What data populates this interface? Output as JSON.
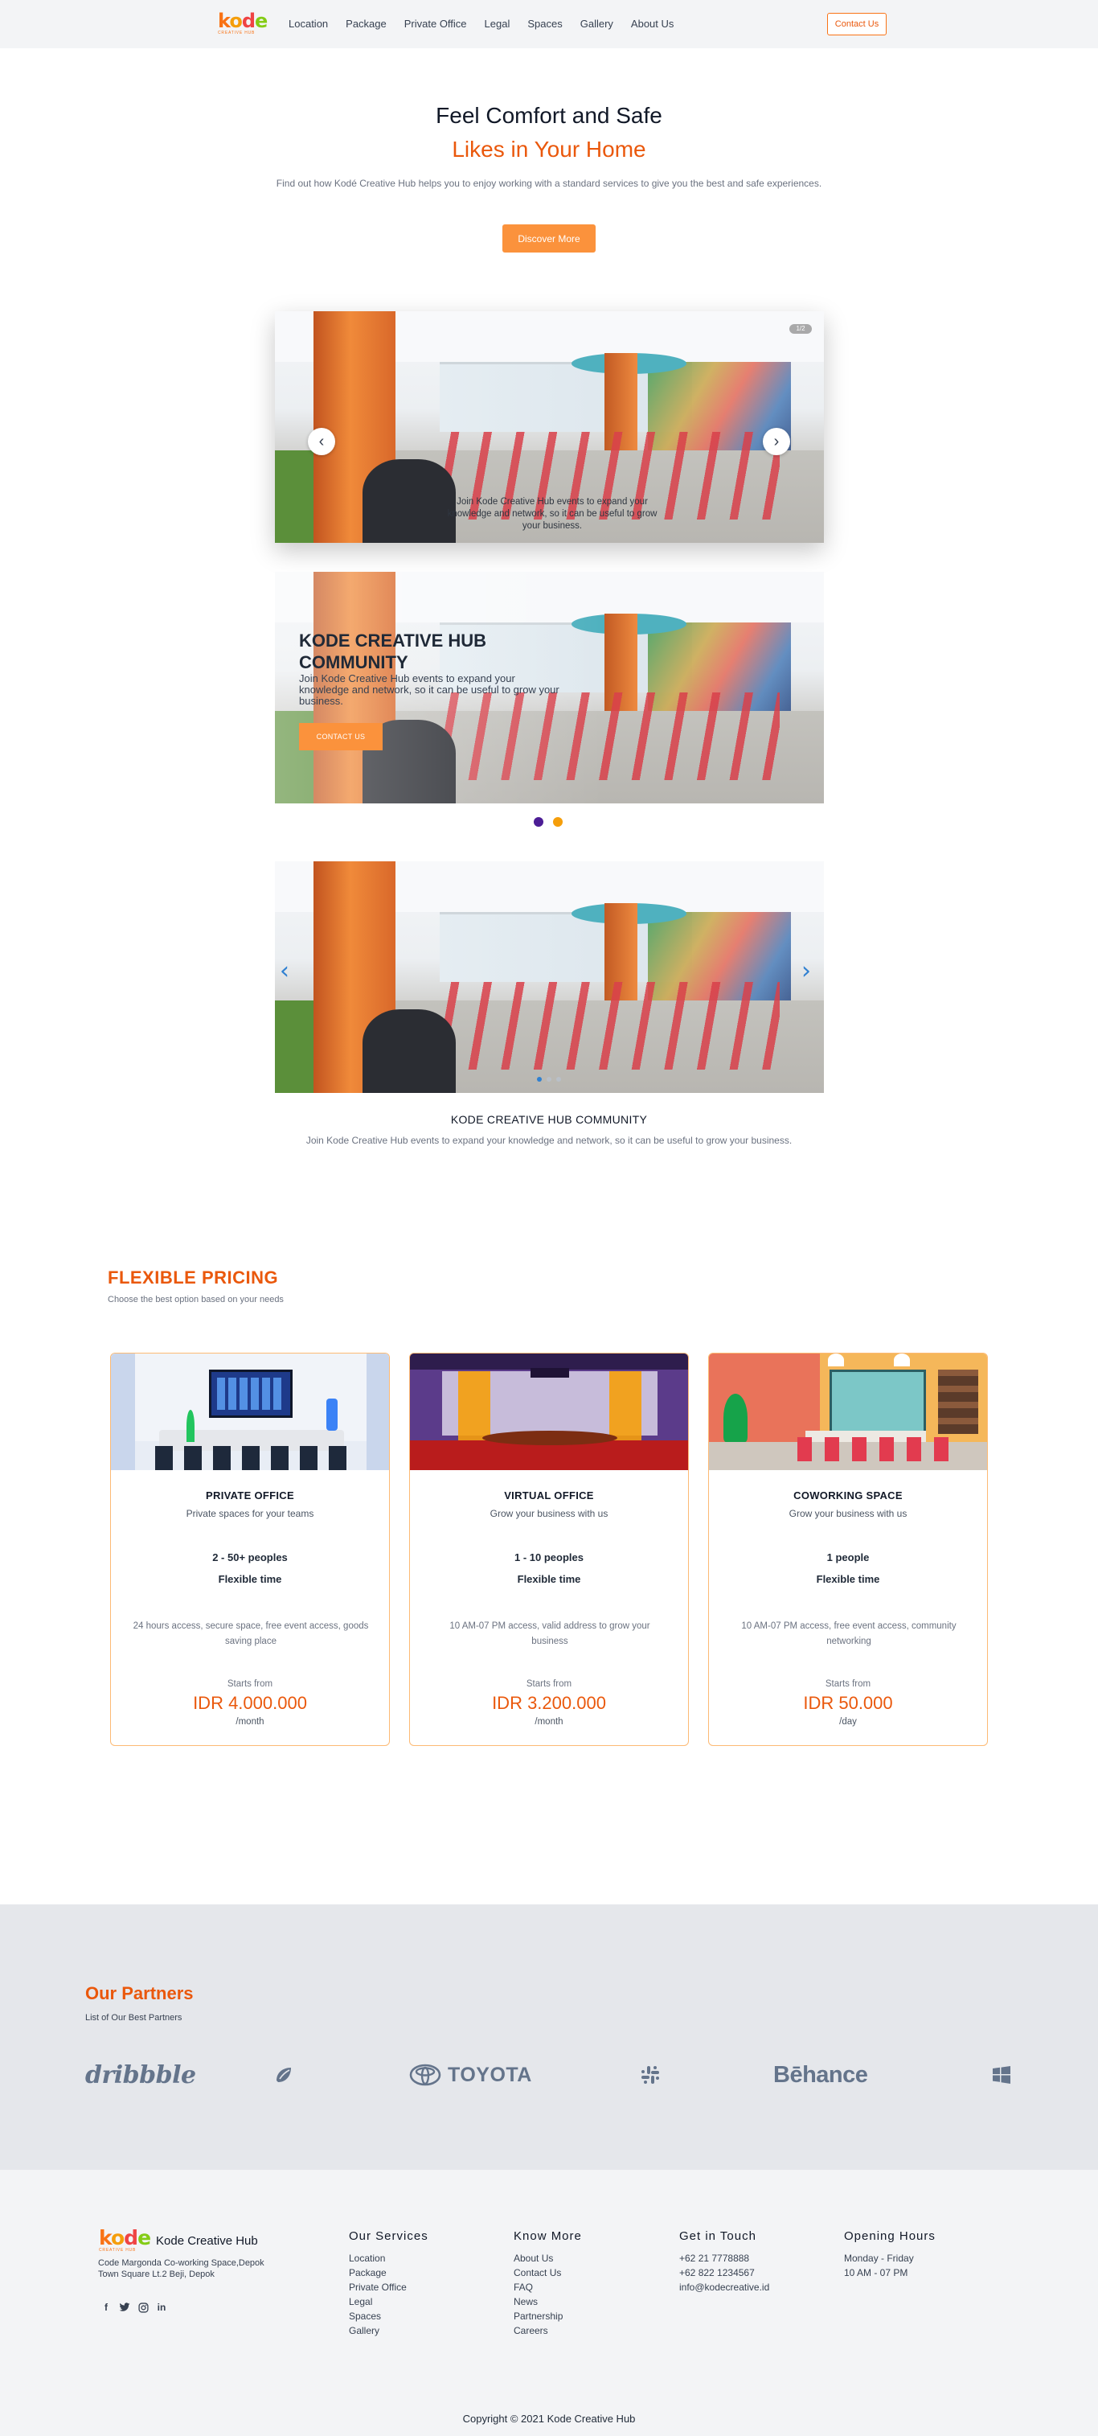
{
  "nav": {
    "logo_text": "kode",
    "logo_sub": "CREATIVE HUB",
    "links": [
      "Location",
      "Package",
      "Private Office",
      "Legal",
      "Spaces",
      "Gallery",
      "About Us"
    ],
    "cta": "Contact Us"
  },
  "hero": {
    "title": "Feel Comfort and Safe",
    "subtitle": "Likes in Your Home",
    "description": "Find out how Kodé Creative Hub helps you to enjoy working with a standard services to give you the best and safe experiences.",
    "button": "Discover More"
  },
  "slider1": {
    "badge": "1/2",
    "caption": "Join Kode Creative Hub events to expand your knowledge and network, so it can be useful to grow your business."
  },
  "slider2": {
    "title": "KODE CREATIVE HUB COMMUNITY",
    "description": "Join Kode Creative Hub events to expand your knowledge and network, so it can be useful to grow your business.",
    "button": "CONTACT US"
  },
  "slider3": {
    "title": "KODE CREATIVE HUB COMMUNITY",
    "description": "Join Kode Creative Hub events to expand your knowledge and network, so it can be useful to grow your business."
  },
  "pricing": {
    "title": "FLEXIBLE PRICING",
    "subtitle": "Choose the best option based on your needs",
    "cards": [
      {
        "name": "PRIVATE OFFICE",
        "tagline": "Private spaces for your teams",
        "people": "2 - 50+ peoples",
        "time": "Flexible time",
        "features": "24 hours access, secure space, free event access, goods saving place",
        "starts": "Starts from",
        "price": "IDR 4.000.000",
        "per": "/month"
      },
      {
        "name": "VIRTUAL OFFICE",
        "tagline": "Grow your business with us",
        "people": "1 - 10 peoples",
        "time": "Flexible time",
        "features": "10 AM-07 PM access, valid address to grow your business",
        "starts": "Starts from",
        "price": "IDR 3.200.000",
        "per": "/month"
      },
      {
        "name": "COWORKING SPACE",
        "tagline": "Grow your business with us",
        "people": "1 people",
        "time": "Flexible time",
        "features": "10 AM-07 PM access, free event access, community networking",
        "starts": "Starts from",
        "price": "IDR 50.000",
        "per": "/day"
      }
    ]
  },
  "partners": {
    "title": "Our Partners",
    "subtitle": "List of Our Best Partners",
    "logos": {
      "dribbble": "dribbble",
      "toyota": "TOYOTA",
      "behance": "Bēhance"
    },
    "icons": [
      "dribbble-logo",
      "drop-logo-icon",
      "toyota-logo",
      "slack-icon",
      "behance-logo",
      "windows-icon"
    ]
  },
  "footer": {
    "brand": "Kode Creative Hub",
    "logo_text": "kode",
    "logo_sub": "CREATIVE HUB",
    "address_line1": "Code Margonda Co-working Space,Depok",
    "address_line2": "Town Square Lt.2 Beji, Depok",
    "social_icons": [
      "facebook-icon",
      "twitter-icon",
      "instagram-icon",
      "linkedin-icon"
    ],
    "social_glyphs": [
      "f",
      "🐦",
      "◎",
      "in"
    ],
    "services": {
      "title": "Our Services",
      "items": [
        "Location",
        "Package",
        "Private Office",
        "Legal",
        "Spaces",
        "Gallery"
      ]
    },
    "know_more": {
      "title": "Know More",
      "items": [
        "About Us",
        "Contact Us",
        "FAQ",
        "News",
        "Partnership",
        "Careers"
      ]
    },
    "get_in_touch": {
      "title": "Get in Touch",
      "items": [
        "+62 21 7778888",
        "+62 822 1234567",
        "info@kodecreative.id"
      ]
    },
    "opening_hours": {
      "title": "Opening Hours",
      "items": [
        "Monday - Friday",
        "10 AM - 07 PM"
      ]
    },
    "copyright": "Copyright © 2021 Kode Creative Hub"
  },
  "colors": {
    "accent": "#ea580c",
    "button": "#fb923c",
    "nav_bg": "#f3f4f6",
    "partners_bg": "#e5e7eb",
    "card_border": "#fdba74"
  }
}
